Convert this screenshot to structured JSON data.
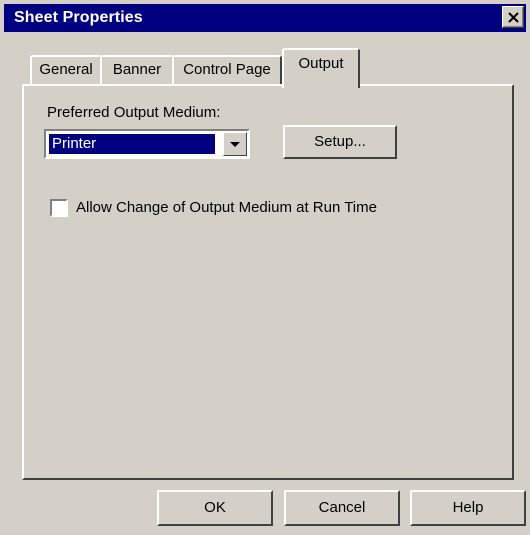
{
  "window": {
    "title": "Sheet Properties",
    "close_icon": "close-icon"
  },
  "tabs": [
    {
      "label": "General",
      "active": false
    },
    {
      "label": "Banner",
      "active": false
    },
    {
      "label": "Control Page",
      "active": false
    },
    {
      "label": "Output",
      "active": true
    }
  ],
  "output": {
    "medium_label": "Preferred Output Medium:",
    "medium_value": "Printer",
    "setup_label": "Setup...",
    "allow_change_label": "Allow Change of Output Medium at Run Time",
    "allow_change_checked": false
  },
  "footer": {
    "ok_label": "OK",
    "cancel_label": "Cancel",
    "help_label": "Help"
  },
  "colors": {
    "title_bar": "#000080",
    "face": "#d4d0c8",
    "selection": "#000080"
  }
}
